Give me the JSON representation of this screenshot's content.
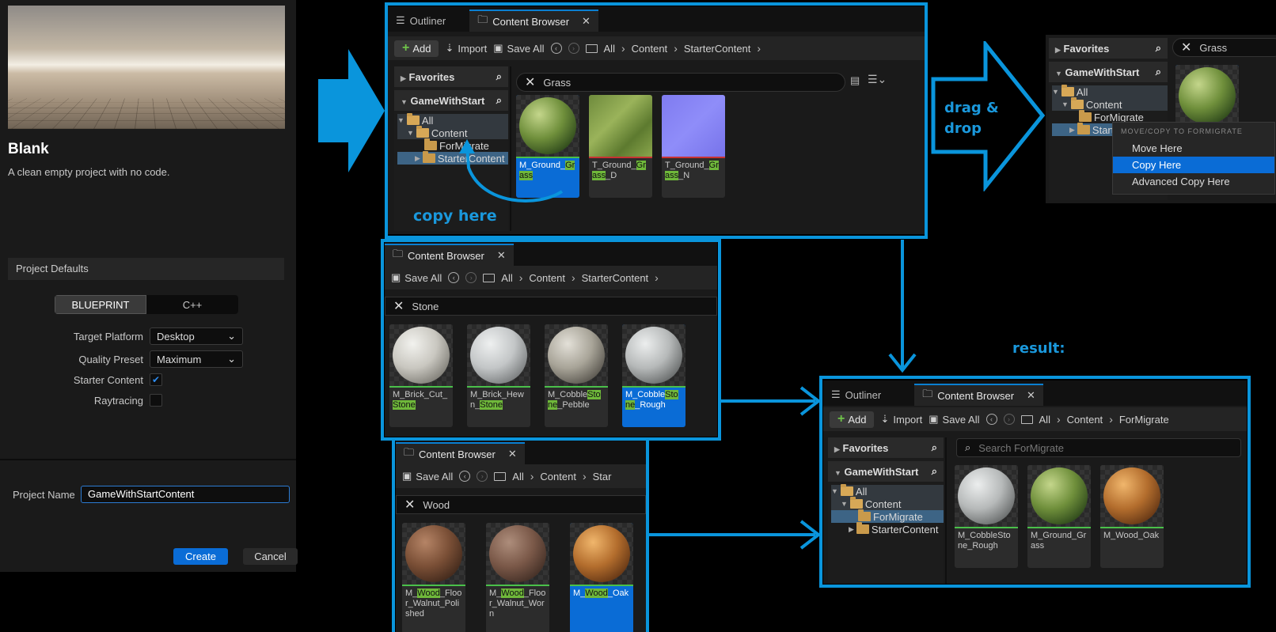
{
  "left": {
    "template_title": "Blank",
    "template_desc": "A clean empty project with no code.",
    "section": "Project Defaults",
    "mode_options": [
      "BLUEPRINT",
      "C++"
    ],
    "settings": [
      {
        "label": "Target Platform",
        "value": "Desktop"
      },
      {
        "label": "Quality Preset",
        "value": "Maximum"
      },
      {
        "label": "Starter Content",
        "checked": true
      },
      {
        "label": "Raytracing",
        "checked": false
      }
    ],
    "project_name_label": "Project Name",
    "project_name_value": "GameWithStartContent",
    "create": "Create",
    "cancel": "Cancel"
  },
  "annotations": {
    "copy_here": "copy here",
    "drag_drop_1": "drag &",
    "drag_drop_2": "drop",
    "result": "result:"
  },
  "cb1": {
    "tab_outliner": "Outliner",
    "tab_cb": "Content Browser",
    "add": "Add",
    "import": "Import",
    "save_all": "Save All",
    "crumbs": [
      "All",
      "Content",
      "StarterContent"
    ],
    "favorites": "Favorites",
    "project": "GameWithStart",
    "tree": [
      "All",
      "Content",
      "ForMigrate",
      "StarterContent"
    ],
    "search": "Grass",
    "assets": [
      {
        "a": "M_Ground_",
        "b": "Grass",
        "c": ""
      },
      {
        "a": "T_Ground_",
        "b": "Grass",
        "c": "_D"
      },
      {
        "a": "T_Ground_",
        "b": "Grass",
        "c": "_N"
      }
    ]
  },
  "dnd": {
    "favorites": "Favorites",
    "project": "GameWithStart",
    "tree": [
      "All",
      "Content",
      "ForMigrate",
      "Starter"
    ],
    "search": "Grass",
    "menu_header": "MOVE/COPY TO FORMIGRATE",
    "menu": [
      "Move Here",
      "Copy Here",
      "Advanced Copy Here"
    ]
  },
  "cb2": {
    "tab": "Content Browser",
    "save_all": "Save All",
    "crumbs": [
      "All",
      "Content",
      "StarterContent"
    ],
    "search": "Stone",
    "assets": [
      {
        "a": "M_Brick_Cut_",
        "b": "Stone",
        "c": ""
      },
      {
        "a": "M_Brick_Hewn_",
        "b": "Stone",
        "c": ""
      },
      {
        "a": "M_Cobble",
        "b": "Stone",
        "c": "_Pebble"
      },
      {
        "a": "M_Cobble",
        "b": "Stone",
        "c": "_Rough"
      }
    ]
  },
  "cb3": {
    "tab": "Content Browser",
    "save_all": "Save All",
    "crumbs": [
      "All",
      "Content",
      "Star"
    ],
    "search": "Wood",
    "assets": [
      {
        "a": "M_",
        "b": "Wood",
        "c": "_Floor_Walnut_Polished"
      },
      {
        "a": "M_",
        "b": "Wood",
        "c": "_Floor_Walnut_Worn"
      },
      {
        "a": "M_",
        "b": "Wood",
        "c": "_Oak"
      }
    ]
  },
  "cb4": {
    "tab_outliner": "Outliner",
    "tab_cb": "Content Browser",
    "add": "Add",
    "import": "Import",
    "save_all": "Save All",
    "crumbs": [
      "All",
      "Content",
      "ForMigrate"
    ],
    "favorites": "Favorites",
    "project": "GameWithStart",
    "tree": [
      "All",
      "Content",
      "ForMigrate",
      "StarterContent"
    ],
    "search_placeholder": "Search ForMigrate",
    "assets": [
      "M_CobbleStone_Rough",
      "M_Ground_Grass",
      "M_Wood_Oak"
    ]
  },
  "colors": {
    "accent": "#0a95dc",
    "highlight": "#6fb83a",
    "selection": "#0a6cd6"
  }
}
